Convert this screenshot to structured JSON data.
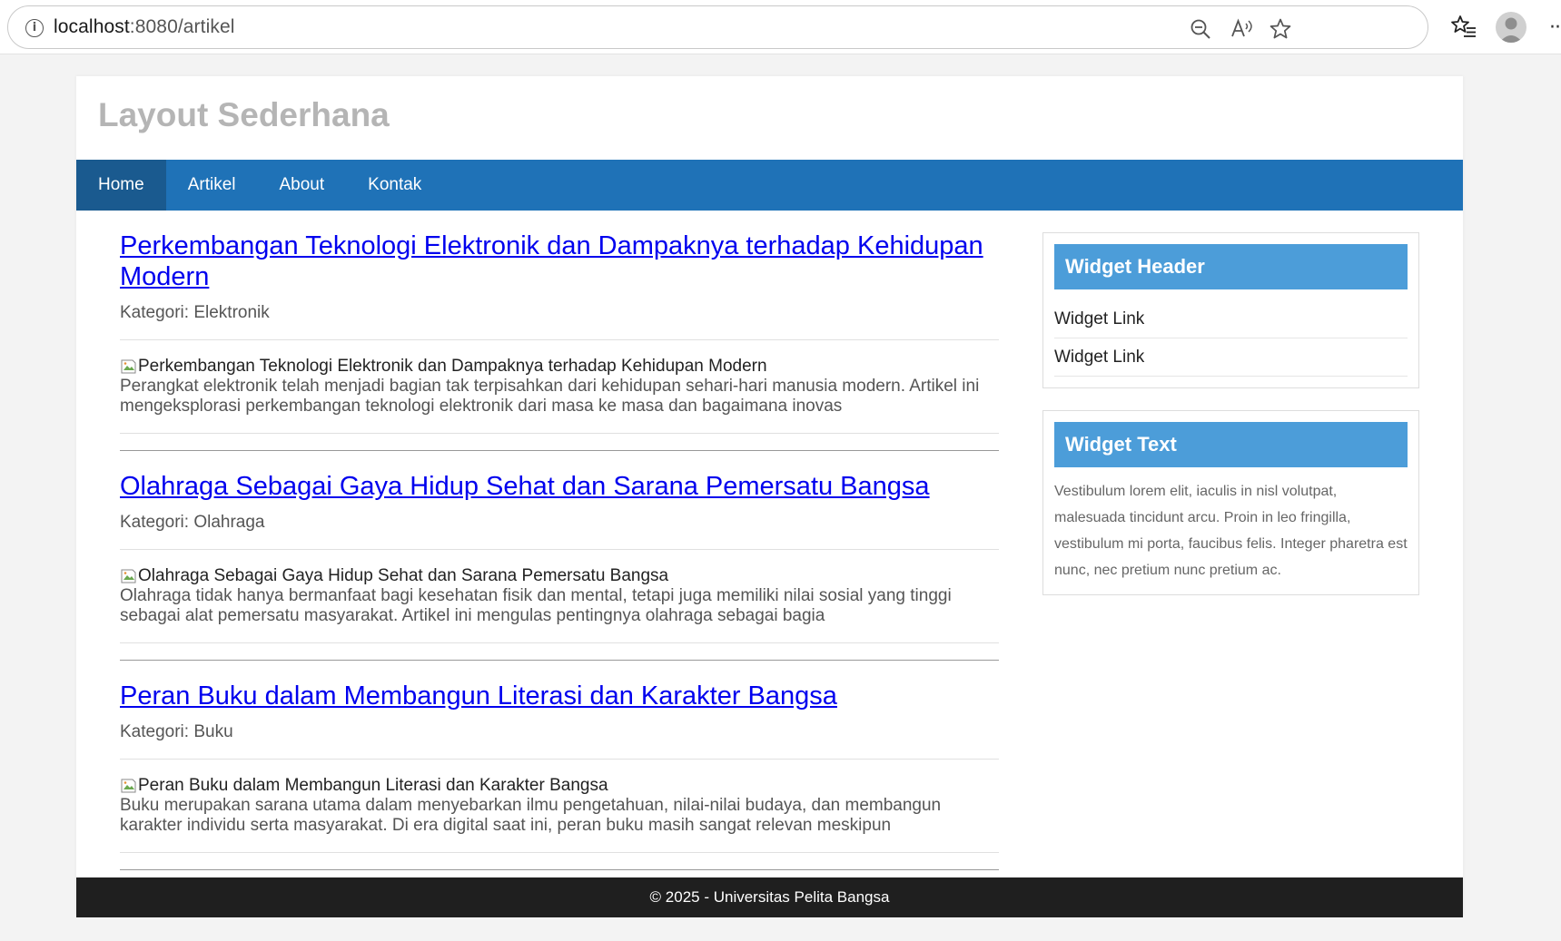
{
  "browser": {
    "url_host": "localhost",
    "url_rest": ":8080/artikel",
    "icons": [
      "info-icon",
      "zoom-out-icon",
      "read-aloud-icon",
      "favorite-star-icon",
      "favorites-list-icon",
      "profile-icon",
      "more-icon"
    ]
  },
  "site": {
    "title": "Layout Sederhana"
  },
  "nav": {
    "items": [
      {
        "label": "Home",
        "active": true
      },
      {
        "label": "Artikel",
        "active": false
      },
      {
        "label": "About",
        "active": false
      },
      {
        "label": "Kontak",
        "active": false
      }
    ]
  },
  "articles": [
    {
      "title": "Perkembangan Teknologi Elektronik dan Dampaknya terhadap Kehidupan Modern",
      "meta": "Kategori: Elektronik",
      "img_alt": "Perkembangan Teknologi Elektronik dan Dampaknya terhadap Kehidupan Modern",
      "excerpt": "Perangkat elektronik telah menjadi bagian tak terpisahkan dari kehidupan sehari-hari manusia modern. Artikel ini mengeksplorasi perkembangan teknologi elektronik dari masa ke masa dan bagaimana inovas"
    },
    {
      "title": "Olahraga Sebagai Gaya Hidup Sehat dan Sarana Pemersatu Bangsa",
      "meta": "Kategori: Olahraga",
      "img_alt": "Olahraga Sebagai Gaya Hidup Sehat dan Sarana Pemersatu Bangsa",
      "excerpt": "Olahraga tidak hanya bermanfaat bagi kesehatan fisik dan mental, tetapi juga memiliki nilai sosial yang tinggi sebagai alat pemersatu masyarakat. Artikel ini mengulas pentingnya olahraga sebagai bagia"
    },
    {
      "title": "Peran Buku dalam Membangun Literasi dan Karakter Bangsa",
      "meta": "Kategori: Buku",
      "img_alt": "Peran Buku dalam Membangun Literasi dan Karakter Bangsa",
      "excerpt": "Buku merupakan sarana utama dalam menyebarkan ilmu pengetahuan, nilai-nilai budaya, dan membangun karakter individu serta masyarakat. Di era digital saat ini, peran buku masih sangat relevan meskipun"
    }
  ],
  "sidebar": {
    "widget1": {
      "header": "Widget Header",
      "links": [
        "Widget Link",
        "Widget Link"
      ]
    },
    "widget2": {
      "header": "Widget Text",
      "text": "Vestibulum lorem elit, iaculis in nisl volutpat, malesuada tincidunt arcu. Proin in leo fringilla, vestibulum mi porta, faucibus felis. Integer pharetra est nunc, nec pretium nunc pretium ac."
    }
  },
  "footer": {
    "text": "© 2025 - Universitas Pelita Bangsa"
  },
  "colors": {
    "nav_bg": "#1f72b7",
    "nav_active": "#1a5a8f",
    "widget_header": "#4c9dd9",
    "footer_bg": "#1f1f1f",
    "link": "#0000ee"
  }
}
